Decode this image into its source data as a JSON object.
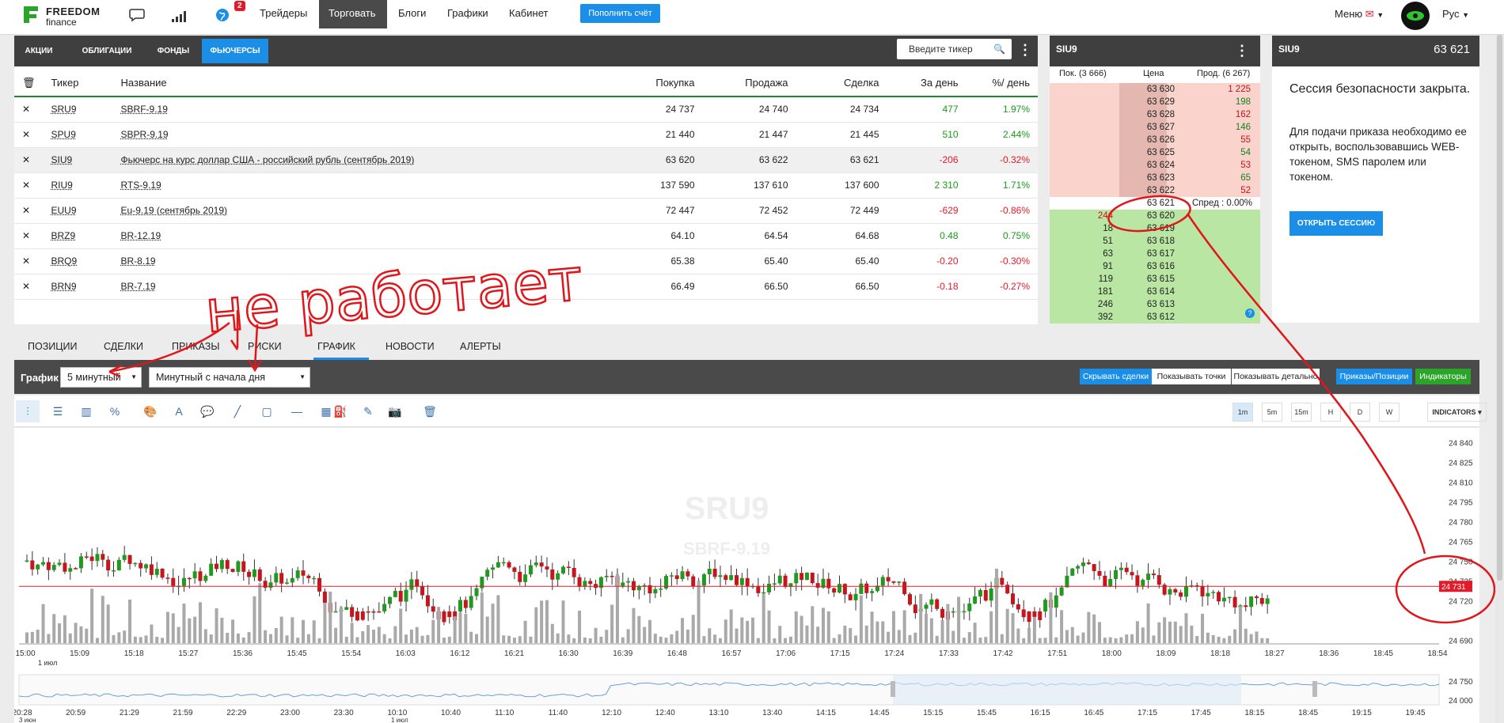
{
  "header": {
    "brand_line1": "FREEDOM",
    "brand_line2": "finance",
    "notif_count": "2",
    "nav": [
      "Трейдеры",
      "Торговать",
      "Блоги",
      "Графики",
      "Кабинет"
    ],
    "topup": "Пополнить счёт",
    "menu": "Меню",
    "lang": "Рус"
  },
  "market_tabs": [
    "АКЦИИ",
    "ОБЛИГАЦИИ",
    "ФОНДЫ",
    "ФЬЮЧЕРСЫ"
  ],
  "search_placeholder": "Введите тикер",
  "table": {
    "headers": [
      "Тикер",
      "Название",
      "Покупка",
      "Продажа",
      "Сделка",
      "За день",
      "%/ день"
    ],
    "rows": [
      {
        "ticker": "SRU9",
        "name": "SBRF-9.19",
        "bid": "24 737",
        "ask": "24 740",
        "last": "24 734",
        "chg": "477",
        "pct": "1.97%"
      },
      {
        "ticker": "SPU9",
        "name": "SBPR-9.19",
        "bid": "21 440",
        "ask": "21 447",
        "last": "21 445",
        "chg": "510",
        "pct": "2.44%"
      },
      {
        "ticker": "SIU9",
        "name": "Фьючерс на курс доллар США - российский рубль (сентябрь 2019)",
        "bid": "63 620",
        "ask": "63 622",
        "last": "63 621",
        "chg": "-206",
        "pct": "-0.32%"
      },
      {
        "ticker": "RIU9",
        "name": "RTS-9.19",
        "bid": "137 590",
        "ask": "137 610",
        "last": "137 600",
        "chg": "2 310",
        "pct": "1.71%"
      },
      {
        "ticker": "EUU9",
        "name": "Eu-9.19 (сентябрь 2019)",
        "bid": "72 447",
        "ask": "72 452",
        "last": "72 449",
        "chg": "-629",
        "pct": "-0.86%"
      },
      {
        "ticker": "BRZ9",
        "name": "BR-12.19",
        "bid": "64.10",
        "ask": "64.54",
        "last": "64.68",
        "chg": "0.48",
        "pct": "0.75%"
      },
      {
        "ticker": "BRQ9",
        "name": "BR-8.19",
        "bid": "65.38",
        "ask": "65.40",
        "last": "65.40",
        "chg": "-0.20",
        "pct": "-0.30%"
      },
      {
        "ticker": "BRN9",
        "name": "BR-7.19",
        "bid": "66.49",
        "ask": "66.50",
        "last": "66.50",
        "chg": "-0.18",
        "pct": "-0.27%"
      }
    ]
  },
  "orderbook": {
    "title": "SIU9",
    "col_buy": "Пок. (3 666)",
    "col_price": "Цена",
    "col_sell": "Прод. (6 267)",
    "asks": [
      [
        "63 630",
        "1 225"
      ],
      [
        "63 629",
        "198"
      ],
      [
        "63 628",
        "162"
      ],
      [
        "63 627",
        "146"
      ],
      [
        "63 626",
        "55"
      ],
      [
        "63 625",
        "54"
      ],
      [
        "63 624",
        "53"
      ],
      [
        "63 623",
        "65"
      ],
      [
        "63 622",
        "52"
      ]
    ],
    "mid": "63 621",
    "spread": "Спред : 0.00%",
    "bids": [
      [
        "244",
        "63 620"
      ],
      [
        "18",
        "63 619"
      ],
      [
        "51",
        "63 618"
      ],
      [
        "63",
        "63 617"
      ],
      [
        "91",
        "63 616"
      ],
      [
        "119",
        "63 615"
      ],
      [
        "181",
        "63 614"
      ],
      [
        "246",
        "63 613"
      ],
      [
        "392",
        "63 612"
      ]
    ]
  },
  "session": {
    "ticker": "SIU9",
    "price": "63 621",
    "closed": "Сессия безопасности закрыта.",
    "text": "Для подачи приказа необходимо ее открыть, воспользовавшись WEB-токеном, SMS паролем или токеном.",
    "button": "ОТКРЫТЬ СЕССИЮ"
  },
  "bottom_tabs": [
    "ПОЗИЦИИ",
    "СДЕЛКИ",
    "ПРИКАЗЫ",
    "РИСКИ",
    "ГРАФИК",
    "НОВОСТИ",
    "АЛЕРТЫ"
  ],
  "chart_panel": {
    "label": "График",
    "interval": "5 минутный",
    "range": "Минутный с начала дня",
    "toggles": [
      "Скрывать сделки",
      "Показывать точки",
      "Показывать детально"
    ],
    "btn_orders": "Приказы/Позиции",
    "btn_ind": "Индикаторы",
    "timeframes": [
      "1m",
      "5m",
      "15m",
      "H",
      "D",
      "W"
    ],
    "indicators": "INDICATORS"
  },
  "annotation": {
    "text": "не работает"
  },
  "chart_data": {
    "type": "candlestick",
    "watermark": "SRU9",
    "watermark2": "SBRF-9.19",
    "y_ticks": [
      "24 840",
      "24 825",
      "24 810",
      "24 795",
      "24 780",
      "24 765",
      "24 750",
      "24 735",
      "24 720",
      "24 690"
    ],
    "x_ticks": [
      "15:00",
      "15:09",
      "15:18",
      "15:27",
      "15:36",
      "15:45",
      "15:54",
      "16:03",
      "16:12",
      "16:21",
      "16:30",
      "16:39",
      "16:48",
      "16:57",
      "17:06",
      "17:15",
      "17:24",
      "17:33",
      "17:42",
      "17:51",
      "18:00",
      "18:09",
      "18:18",
      "18:27",
      "18:36",
      "18:45",
      "18:54"
    ],
    "x_date": "1 июл",
    "current_price": "24 731",
    "nav_y_ticks": [
      "24 750",
      "24 000"
    ],
    "nav_x_ticks": [
      "20:28",
      "20:59",
      "21:29",
      "21:59",
      "22:29",
      "23:00",
      "23:30",
      "10:10",
      "10:40",
      "11:10",
      "11:40",
      "12:10",
      "12:40",
      "13:10",
      "13:40",
      "14:15",
      "14:45",
      "15:15",
      "15:45",
      "16:15",
      "16:45",
      "17:15",
      "17:45",
      "18:15",
      "18:45",
      "19:15",
      "19:45"
    ],
    "nav_dates": [
      "3 июн",
      "1 июл"
    ]
  },
  "colors": {
    "up": "#1f9a1f",
    "down": "#c4161c",
    "accent": "#1b8ee8",
    "annotation": "#e0161b"
  }
}
